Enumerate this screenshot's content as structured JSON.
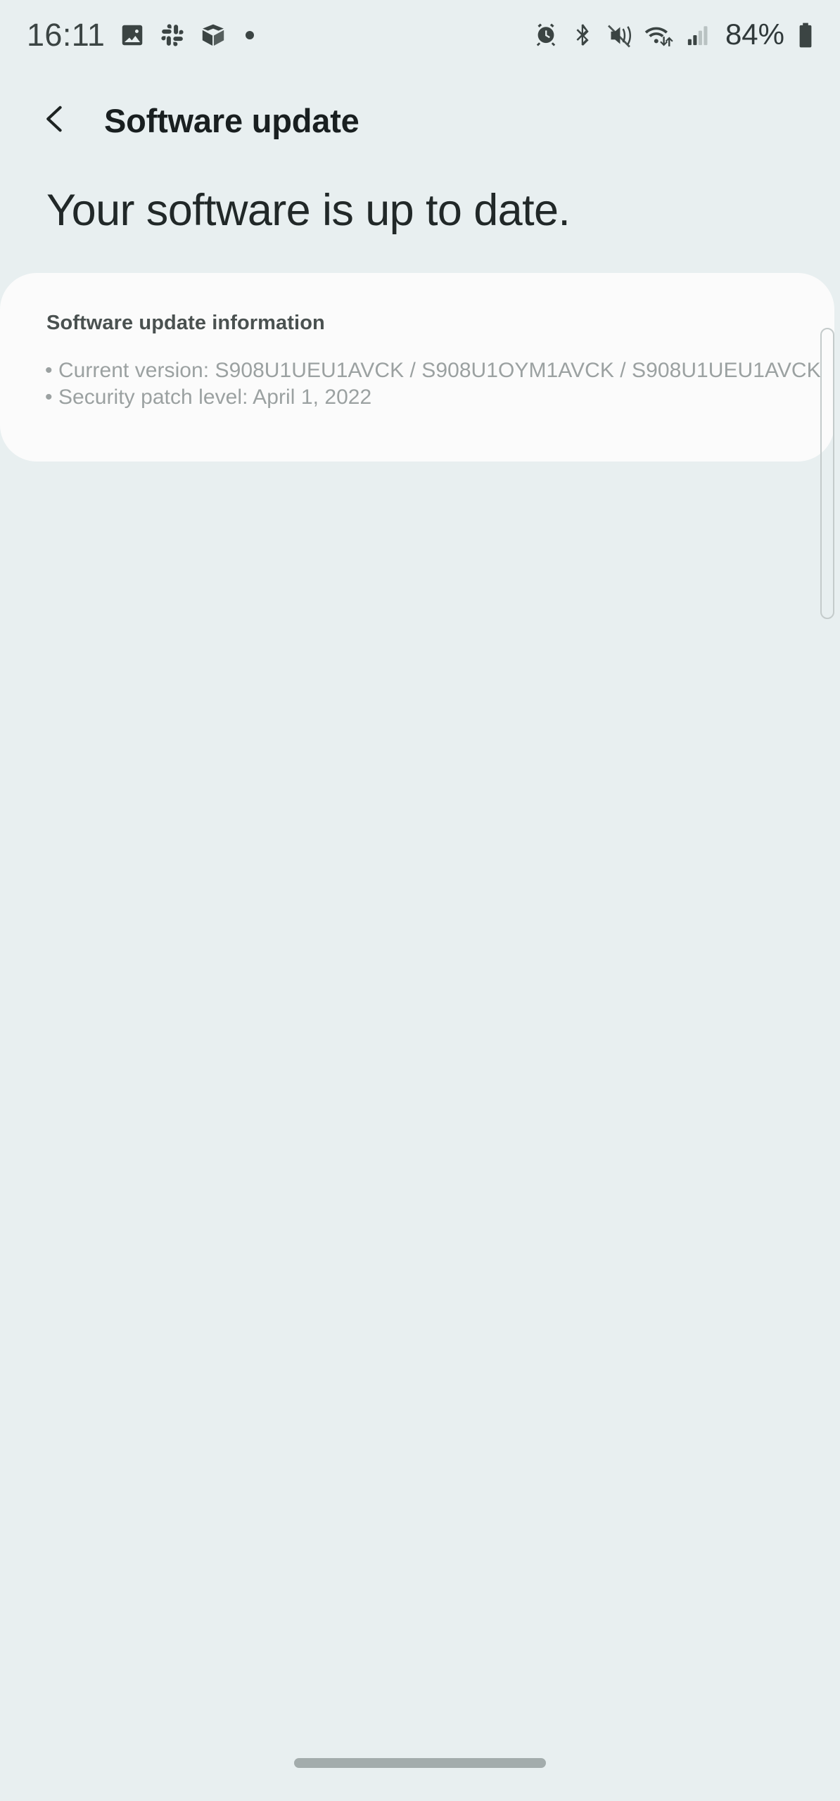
{
  "status_bar": {
    "clock": "16:11",
    "left_icons": [
      {
        "name": "gallery-icon",
        "label": "Gallery"
      },
      {
        "name": "slack-icon",
        "label": "Slack"
      },
      {
        "name": "package-icon",
        "label": "Package tracking"
      }
    ],
    "more_notifications_indicator": "•",
    "right_icons": [
      {
        "name": "alarm-icon",
        "label": "Alarm set"
      },
      {
        "name": "bluetooth-icon",
        "label": "Bluetooth on"
      },
      {
        "name": "mute-vibrate-icon",
        "label": "Sound muted / vibrate"
      },
      {
        "name": "wifi-data-icon",
        "label": "Wi-Fi connected, data active"
      },
      {
        "name": "signal-icon",
        "label": "Mobile signal"
      }
    ],
    "battery_percent": "84%",
    "battery_icon": "battery-icon"
  },
  "app_bar": {
    "back_icon": "chevron-left-icon",
    "title": "Software update"
  },
  "main": {
    "headline": "Your software is up to date.",
    "card": {
      "title": "Software update information",
      "lines": [
        "• Current version: S908U1UEU1AVCK / S908U1OYM1AVCK / S908U1UEU1AVCK",
        "• Security patch level: April 1, 2022"
      ]
    }
  },
  "scroll": {
    "indicator": "vertical-scroll-indicator"
  },
  "nav": {
    "gesture_handle": "home-gesture-handle"
  },
  "colors": {
    "background": "#e8eff0",
    "card_background": "#fbfbfb",
    "headline_text": "#212828",
    "title_text": "#191f20",
    "card_title_text": "#4a5150",
    "card_body_text": "#9ba1a1",
    "status_icon": "#3b4443",
    "gesture_handle": "#a3acac",
    "scroll_indicator": "#c4cbcb"
  }
}
